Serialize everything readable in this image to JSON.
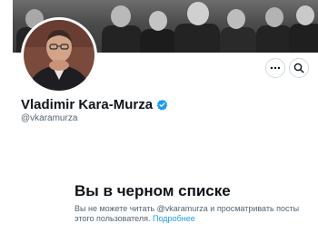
{
  "profile": {
    "display_name": "Vladimir Kara-Murza",
    "handle": "@vkaramurza",
    "verified": true
  },
  "actions": {
    "more_icon": "more-horizontal-icon",
    "search_icon": "search-icon"
  },
  "blocked": {
    "title": "Вы в черном списке",
    "message": "Вы не можете читать @vkaramurza и просматривать посты этого пользователя.",
    "learn_more": "Подробнее"
  },
  "colors": {
    "accent": "#1d9bf0",
    "secondary_text": "#536471",
    "primary_text": "#0f1419",
    "border": "#cfd9de"
  }
}
